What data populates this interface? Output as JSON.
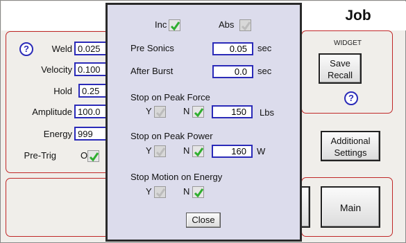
{
  "header": {
    "job_title": "Job"
  },
  "left_panel": {
    "fields": [
      {
        "label": "Weld",
        "value": "0.025"
      },
      {
        "label": "Velocity",
        "value": "0.100"
      },
      {
        "label": "Hold",
        "value": "0.25"
      },
      {
        "label": "Amplitude",
        "value": "100.0"
      },
      {
        "label": "Energy",
        "value": "999"
      }
    ],
    "help_symbol": "?",
    "pretrig": {
      "label": "Pre-Trig",
      "value": "Off"
    }
  },
  "right_panel": {
    "widget_label": "WIDGET",
    "save_recall_line1": "Save",
    "save_recall_line2": "Recall",
    "help_symbol": "?"
  },
  "buttons": {
    "additional_line1": "Additional",
    "additional_line2": "Settings",
    "main": "Main"
  },
  "modal": {
    "inc_label": "Inc",
    "abs_label": "Abs",
    "pre_sonics": {
      "label": "Pre Sonics",
      "value": "0.05",
      "unit": "sec"
    },
    "after_burst": {
      "label": "After Burst",
      "value": "0.0",
      "unit": "sec"
    },
    "peak_force": {
      "title": "Stop on Peak Force",
      "y": "Y",
      "n": "N",
      "value": "150",
      "unit": "Lbs"
    },
    "peak_power": {
      "title": "Stop on Peak Power",
      "y": "Y",
      "n": "N",
      "value": "160",
      "unit": "W"
    },
    "motion_energy": {
      "title": "Stop Motion on Energy",
      "y": "Y",
      "n": "N"
    },
    "close_label": "Close"
  },
  "colors": {
    "accent_border": "#c02626",
    "input_border": "#2a2ab8",
    "check_green": "#2fae2f",
    "modal_bg": "#dcdcec"
  }
}
